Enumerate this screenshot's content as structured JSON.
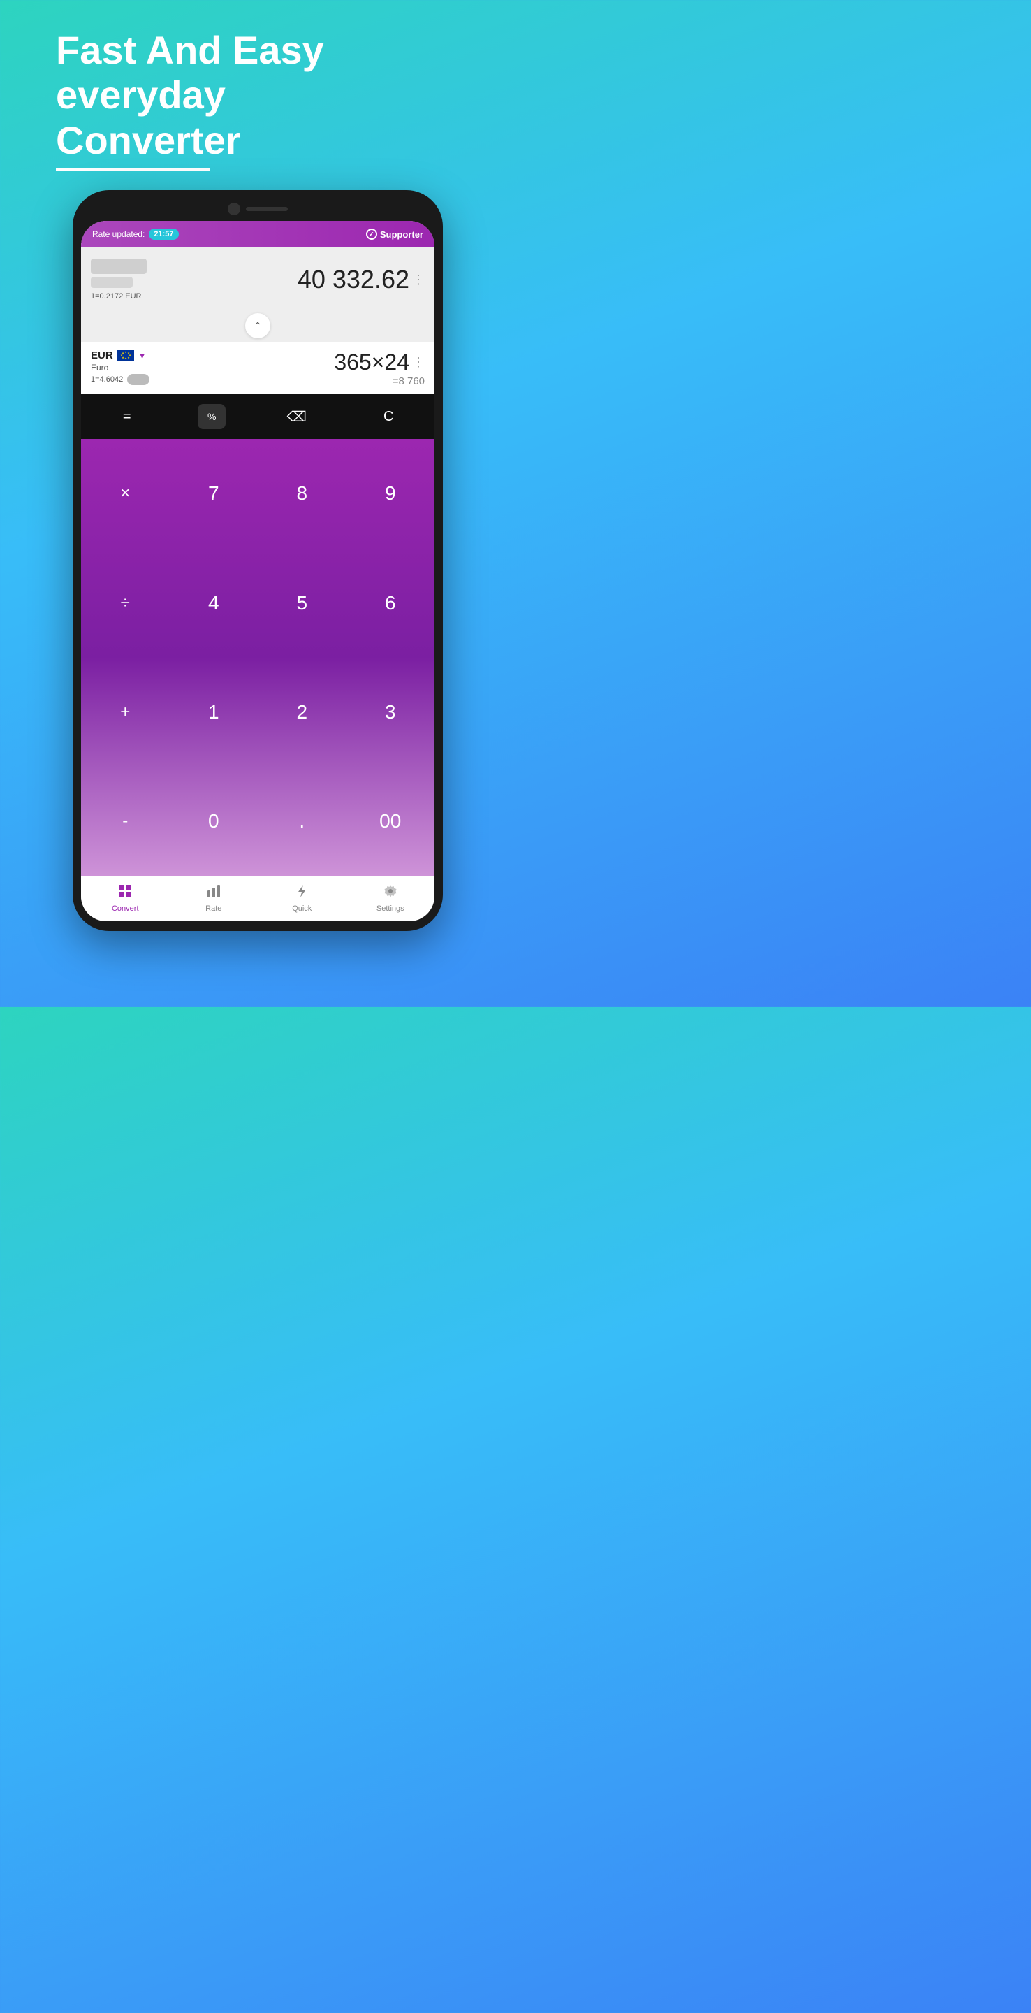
{
  "hero": {
    "line1": "Fast And Easy",
    "line2": "everyday",
    "line3": "Converter"
  },
  "statusBar": {
    "rateLabel": "Rate updated:",
    "time": "21:57",
    "supporterLabel": "Supporter"
  },
  "converter": {
    "topAmount": "40 332.62",
    "topRate": "1=0.2172 EUR",
    "chevron": "^",
    "bottomCurrency": "EUR",
    "bottomCurrencyFull": "Euro",
    "bottomRate": "1=4.6042",
    "expression": "365×24",
    "result": "=8 760"
  },
  "keypadTop": {
    "equals": "=",
    "percent": "%",
    "backspace": "⌫",
    "clear": "C"
  },
  "keypad": [
    {
      "label": "×",
      "type": "operator"
    },
    {
      "label": "7",
      "type": "number"
    },
    {
      "label": "8",
      "type": "number"
    },
    {
      "label": "9",
      "type": "number"
    },
    {
      "label": "÷",
      "type": "operator"
    },
    {
      "label": "4",
      "type": "number"
    },
    {
      "label": "5",
      "type": "number"
    },
    {
      "label": "6",
      "type": "number"
    },
    {
      "label": "+",
      "type": "operator"
    },
    {
      "label": "1",
      "type": "number"
    },
    {
      "label": "2",
      "type": "number"
    },
    {
      "label": "3",
      "type": "number"
    },
    {
      "label": "-",
      "type": "operator"
    },
    {
      "label": "0",
      "type": "number"
    },
    {
      "label": ".",
      "type": "number"
    },
    {
      "label": "00",
      "type": "number"
    }
  ],
  "bottomNav": [
    {
      "label": "Convert",
      "active": true,
      "icon": "grid"
    },
    {
      "label": "Rate",
      "active": false,
      "icon": "bar-chart"
    },
    {
      "label": "Quick",
      "active": false,
      "icon": "flash"
    },
    {
      "label": "Settings",
      "active": false,
      "icon": "gear"
    }
  ]
}
